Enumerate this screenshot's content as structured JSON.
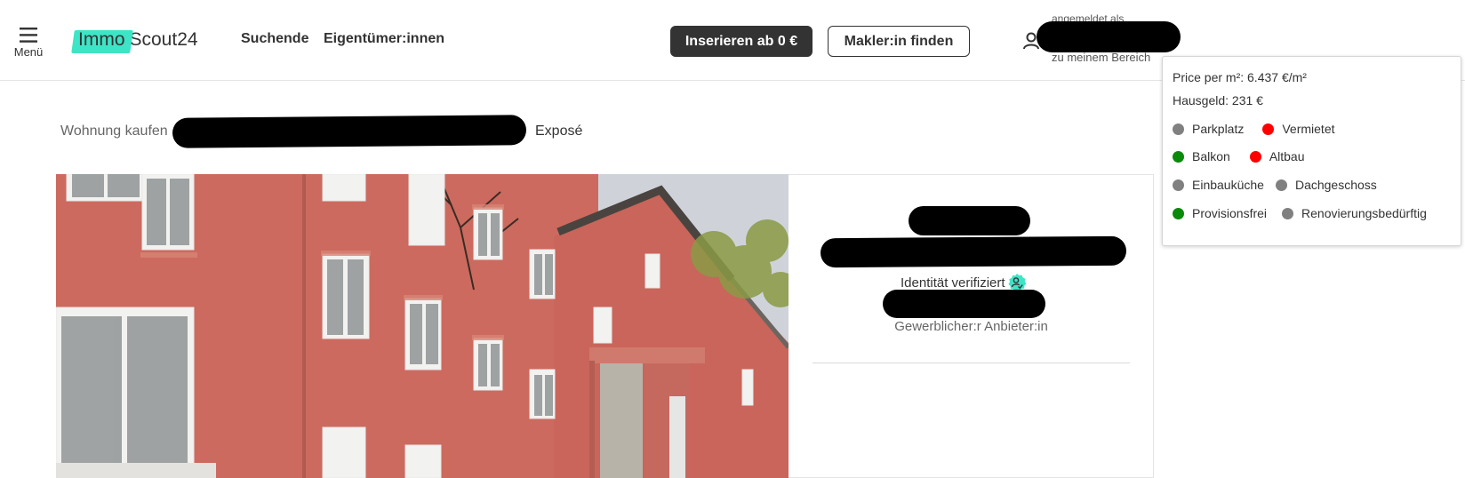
{
  "header": {
    "menu_label": "Menü",
    "logo_part1": "Immo",
    "logo_part2": "Scout24",
    "nav": [
      "Suchende",
      "Eigentümer:innen"
    ],
    "cta_primary": "Inserieren ab 0 €",
    "cta_secondary": "Makler:in finden",
    "logged_in_as": "angemeldet als",
    "my_area": "zu meinem Bereich"
  },
  "breadcrumb": {
    "first": "Wohnung kaufen",
    "current": "Exposé"
  },
  "contact": {
    "verified_label": "Identität verifiziert",
    "provider_type": "Gewerblicher:r Anbieter:in"
  },
  "tooltip": {
    "price_per_sqm": "Price per m²: 6.437 €/m²",
    "hausgeld": "Hausgeld: 231 €",
    "features": [
      [
        {
          "label": "Parkplatz",
          "status": "grey"
        },
        {
          "label": "Vermietet",
          "status": "red"
        }
      ],
      [
        {
          "label": "Balkon",
          "status": "green"
        },
        {
          "label": "Altbau",
          "status": "red"
        }
      ],
      [
        {
          "label": "Einbauküche",
          "status": "grey"
        },
        {
          "label": "Dachgeschoss",
          "status": "grey"
        }
      ],
      [
        {
          "label": "Provisionsfrei",
          "status": "green"
        },
        {
          "label": "Renovierungsbedürftig",
          "status": "grey"
        }
      ]
    ]
  },
  "colors": {
    "brand_accent": "#3ce5c5",
    "dark_button": "#333333",
    "status_grey": "#808080",
    "status_green": "#0a8a0a",
    "status_red": "#ff0000"
  }
}
